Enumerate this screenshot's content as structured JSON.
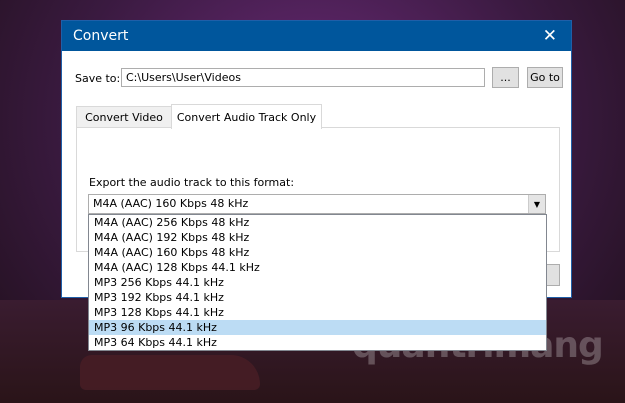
{
  "window": {
    "title": "Convert"
  },
  "save_to": {
    "label": "Save to:",
    "value": "C:\\Users\\User\\Videos",
    "browse_label": "...",
    "goto_label": "Go to"
  },
  "tabs": [
    {
      "label": "Convert Video",
      "active": false
    },
    {
      "label": "Convert Audio Track Only",
      "active": true
    }
  ],
  "export": {
    "label": "Export the audio track to this format:",
    "selected": "M4A (AAC) 160 Kbps 48 kHz"
  },
  "options": [
    "M4A (AAC) 256 Kbps 48 kHz",
    "M4A (AAC) 192 Kbps 48 kHz",
    "M4A (AAC) 160 Kbps 48 kHz",
    "M4A (AAC) 128 Kbps 44.1 kHz",
    "MP3 256 Kbps 44.1 kHz",
    "MP3 192 Kbps 44.1 kHz",
    "MP3 128 Kbps 44.1 kHz",
    "MP3 96 Kbps 44.1 kHz",
    "MP3 64 Kbps 44.1 kHz"
  ],
  "highlighted_index": 7,
  "watermark": "quantrimang",
  "colors": {
    "titlebar": "#00569c",
    "highlight": "#bcdcf4"
  }
}
